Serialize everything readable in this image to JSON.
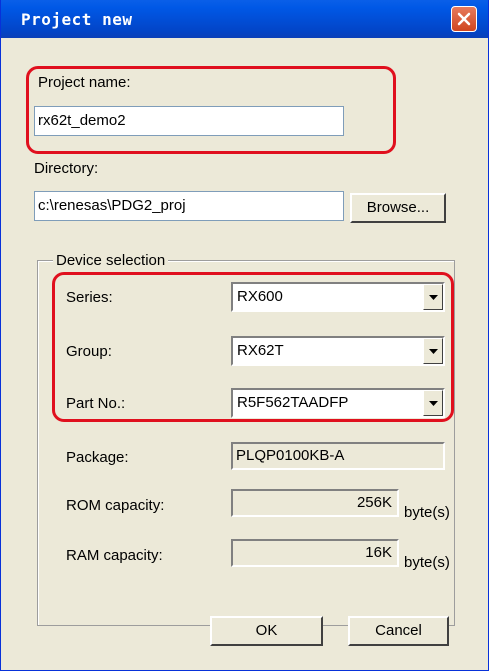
{
  "window": {
    "title": "Project new"
  },
  "project_name": {
    "label": "Project name:",
    "value": "rx62t_demo2"
  },
  "directory": {
    "label": "Directory:",
    "value": "c:\\renesas\\PDG2_proj",
    "browse_label": "Browse..."
  },
  "device_selection": {
    "group_label": "Device selection",
    "series": {
      "label": "Series:",
      "value": "RX600"
    },
    "group": {
      "label": "Group:",
      "value": "RX62T"
    },
    "part_no": {
      "label": "Part No.:",
      "value": "R5F562TAADFP"
    },
    "package": {
      "label": "Package:",
      "value": "PLQP0100KB-A"
    },
    "rom": {
      "label": "ROM capacity:",
      "value": "256K",
      "unit": "byte(s)"
    },
    "ram": {
      "label": "RAM capacity:",
      "value": "16K",
      "unit": "byte(s)"
    }
  },
  "buttons": {
    "ok": "OK",
    "cancel": "Cancel"
  },
  "colors": {
    "title_bar": "#0245c8",
    "highlight": "#e0101e",
    "dialog_bg": "#ece9d8"
  },
  "icons": {
    "close": "close-icon",
    "dropdown": "chevron-down-icon"
  }
}
